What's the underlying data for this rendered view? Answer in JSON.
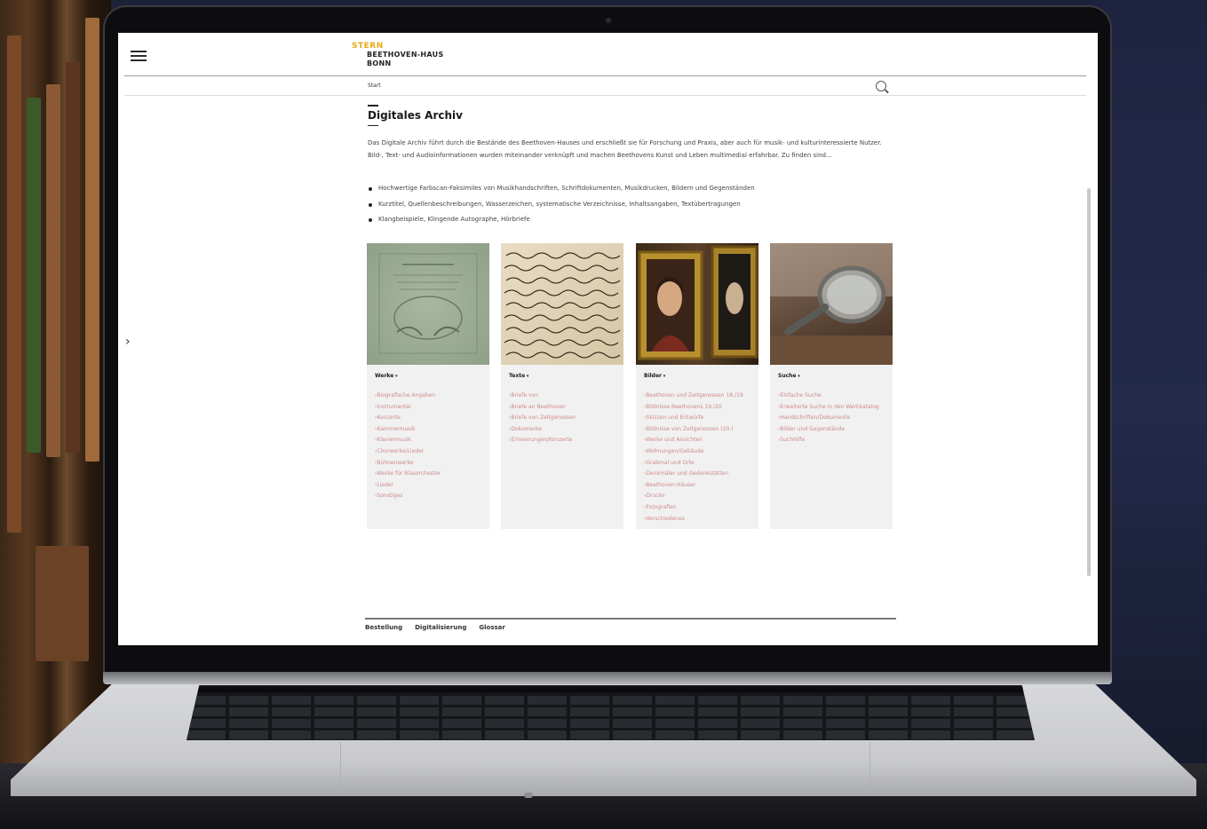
{
  "site": {
    "logo_top": "STERN",
    "logo_line1": "BEETHOVEN-HAUS",
    "logo_line2": "BONN"
  },
  "nav": {
    "breadcrumb": "Start",
    "menu_icon": "hamburger-menu-icon",
    "search_icon": "search-icon"
  },
  "main": {
    "title": "Digitales Archiv",
    "intro": "Das Digitale Archiv führt durch die Bestände des Beethoven-Hauses und erschließt sie für Forschung und Praxis, aber auch für musik- und kulturinteressierte Nutzer. Bild-, Text- und Audioinformationen wurden miteinander verknüpft und machen Beethovens Kunst und Leben multimedial erfahrbar. Zu finden sind...",
    "bullets": [
      "Hochwertige Farbscan-Faksimiles von Musikhandschriften, Schriftdokumenten, Musikdrucken, Bildern und Gegenständen",
      "Kurztitel, Quellenbeschreibungen, Wasserzeichen, systematische Verzeichnisse, Inhaltsangaben, Textübertragungen",
      "Klangbeispiele, Klingende Autographe, Hörbriefe"
    ]
  },
  "cards": [
    {
      "heading": "Werke",
      "image": "green-music-print-title-page",
      "links": [
        "Biografische Angaben",
        "Instrumental",
        "Konzerte",
        "Kammermusik",
        "Klaviermusik",
        "Chorwerke/Lieder",
        "Bühnenwerke",
        "Werke für Blasorchester",
        "Lieder",
        "Sonstiges"
      ]
    },
    {
      "heading": "Texte",
      "image": "handwritten-manuscript-letter",
      "links": [
        "Briefe von",
        "Briefe an Beethoven",
        "Briefe von Zeitgenossen",
        "Dokumente",
        "Erinnerungen/Konzerte"
      ]
    },
    {
      "heading": "Bilder",
      "image": "framed-portrait-paintings",
      "links": [
        "Beethoven und Zeitgenossen 18./19.",
        "Bildnisse Beethovens 19./20.",
        "Skizzen und Entwürfe",
        "Bildnisse von Zeitgenossen (20.)",
        "Werke und Ansichten",
        "Wohnungen/Gebäude",
        "Grabmal und Orte",
        "Denkmäler und Gedenkstätten",
        "Beethoven-Häuser",
        "Drucke",
        "Fotografien",
        "Verschiedenes"
      ]
    },
    {
      "heading": "Suche",
      "image": "magnifying-glass-on-books",
      "links": [
        "Einfache Suche",
        "Erweiterte Suche in den Werkkatalog",
        "Handschriften/Dokumente",
        "Bilder und Gegenstände",
        "Suchhilfe"
      ]
    }
  ],
  "footer": {
    "links": [
      "Bestellung",
      "Digitalisierung",
      "Glossar"
    ]
  }
}
